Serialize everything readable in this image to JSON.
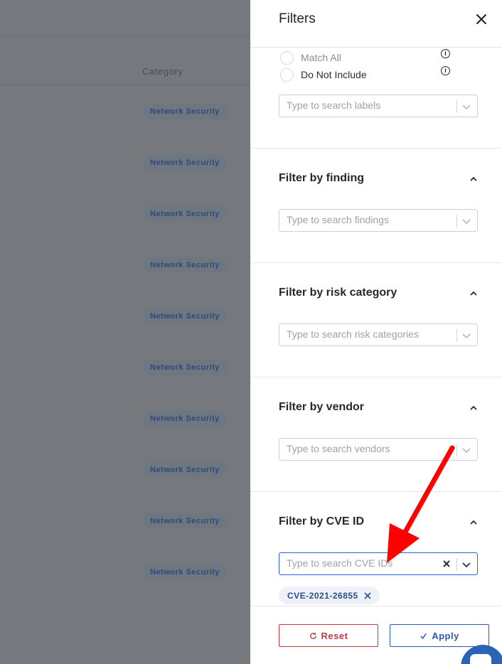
{
  "background_table": {
    "column_header": "Category",
    "rows": [
      {
        "category": "Network Security"
      },
      {
        "category": "Network Security"
      },
      {
        "category": "Network Security"
      },
      {
        "category": "Network Security"
      },
      {
        "category": "Network Security"
      },
      {
        "category": "Network Security"
      },
      {
        "category": "Network Security"
      },
      {
        "category": "Network Security"
      },
      {
        "category": "Network Security"
      },
      {
        "category": "Network Security"
      }
    ]
  },
  "panel": {
    "title": "Filters",
    "close_icon": "close-icon",
    "labels_section": {
      "match_all_label": "Match All",
      "do_not_include_label": "Do Not Include",
      "search_placeholder": "Type to search labels"
    },
    "sections": [
      {
        "title": "Filter by finding",
        "placeholder": "Type to search findings"
      },
      {
        "title": "Filter by risk category",
        "placeholder": "Type to search risk categories"
      },
      {
        "title": "Filter by vendor",
        "placeholder": "Type to search vendors"
      },
      {
        "title": "Filter by CVE ID",
        "placeholder": "Type to search CVE IDs"
      }
    ],
    "selected_cve_chips": [
      {
        "label": "CVE-2021-26855"
      }
    ],
    "footer": {
      "reset_label": "Reset",
      "apply_label": "Apply",
      "reset_icon": "refresh-icon",
      "apply_icon": "check-icon"
    }
  },
  "colors": {
    "accent": "#2d63d6",
    "danger": "#c23a44",
    "annotation_arrow": "#ff0000"
  }
}
